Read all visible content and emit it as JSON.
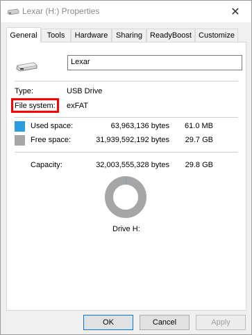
{
  "window": {
    "title": "Lexar (H:) Properties",
    "close_glyph": "✕"
  },
  "tabs": [
    {
      "label": "General",
      "active": true
    },
    {
      "label": "Tools",
      "active": false
    },
    {
      "label": "Hardware",
      "active": false
    },
    {
      "label": "Sharing",
      "active": false
    },
    {
      "label": "ReadyBoost",
      "active": false
    },
    {
      "label": "Customize",
      "active": false
    }
  ],
  "general": {
    "volume_name": "Lexar",
    "type_label": "Type:",
    "type_value": "USB Drive",
    "fs_label": "File system:",
    "fs_value": "exFAT",
    "used": {
      "label": "Used space:",
      "bytes": "63,963,136 bytes",
      "size": "61.0 MB",
      "color": "#2b9ce0"
    },
    "free": {
      "label": "Free space:",
      "bytes": "31,939,592,192 bytes",
      "size": "29.7 GB",
      "color": "#a6a6a6"
    },
    "capacity": {
      "label": "Capacity:",
      "bytes": "32,003,555,328 bytes",
      "size": "29.8 GB"
    },
    "used_fraction": 0.002,
    "drive_label": "Drive H:"
  },
  "buttons": {
    "ok": "OK",
    "cancel": "Cancel",
    "apply": "Apply"
  },
  "highlight_color": "#ff0000"
}
